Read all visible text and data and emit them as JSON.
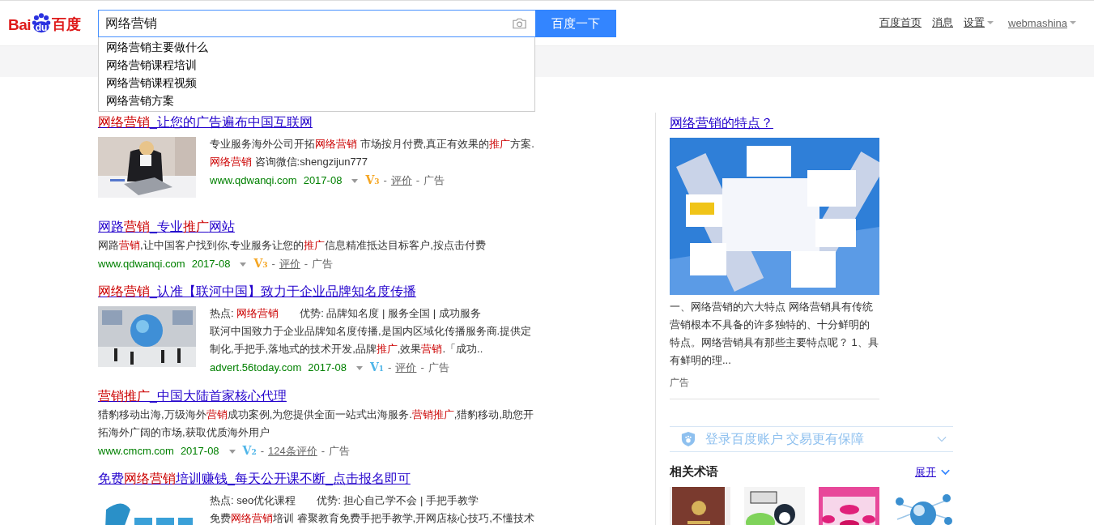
{
  "logo": {
    "left": "Bai",
    "badge": "du",
    "right": "百度"
  },
  "search": {
    "value": "网络营销",
    "button": "百度一下"
  },
  "suggestions": [
    "网络营销主要做什么",
    "网络营销课程培训",
    "网络营销课程视频",
    "网络营销方案"
  ],
  "nav": [
    {
      "label": "百度首页",
      "dropdown": false
    },
    {
      "label": "消息",
      "dropdown": false
    },
    {
      "label": "设置",
      "dropdown": true
    },
    {
      "label": "webmashina",
      "dropdown": true
    }
  ],
  "results": [
    {
      "title": "**网络营销**_让您的广告遍布中国互联网",
      "thumb": {
        "kind": "picture"
      },
      "lines": [
        "专业服务海外公司开拓**网络营销** 市场按月付费,真正有效果的**推广**方案.",
        "**网络营销** 咨询微信:shengzijun777"
      ],
      "meta": {
        "url": "www.qdwanqi.com",
        "date": "2017-08",
        "vip": "V3",
        "color": "#f5a623",
        "sep": "-",
        "review": "评价",
        "ad": "广告"
      }
    },
    {
      "title": "网路**营销**_专业**推广**网站",
      "lines": [
        "网路**营销**,让中国客户找到你,专业服务让您的**推广**信息精准抵达目标客户,按点击付费"
      ],
      "meta": {
        "url": "www.qdwanqi.com",
        "date": "2017-08",
        "vip": "V3",
        "color": "#f5a623",
        "sep": "-",
        "review": "评价",
        "ad": "广告"
      }
    },
    {
      "title": "**网络营销**_认准【联河中国】致力于企业品牌知名度传播",
      "thumb": {
        "kind": "picture"
      },
      "tags": [
        "热点: **网络营销**",
        "优势: 品牌知名度 | 服务全国 | 成功服务"
      ],
      "lines": [
        "联河中国致力于企业品牌知名度传播,是国内区域化传播服务商.提供定",
        "制化,手把手,落地式的技术开发,品牌**推广**,效果**营销**.「成功.."
      ],
      "meta": {
        "url": "advert.56today.com",
        "date": "2017-08",
        "vip": "V1",
        "color": "#4fb5e8",
        "sep": "-",
        "review": "评价",
        "ad": "广告"
      }
    },
    {
      "title": "**营销推广**_中国大陆首家核心代理",
      "lines": [
        "猎豹移动出海,万级海外**营销**成功案例,为您提供全面一站式出海服务.**营销推广**,猎豹移动,助您开",
        "拓海外广阔的市场,获取优质海外用户"
      ],
      "meta": {
        "url": "www.cmcm.com",
        "date": "2017-08",
        "vip": "V2",
        "color": "#4fb5e8",
        "sep": "-",
        "review": "124条评价",
        "ad": "广告"
      }
    },
    {
      "title": "免费**网络营销**培训赚钱_每天公开课不断_点击报名即可",
      "thumb": {
        "kind": "picture"
      },
      "tags": [
        "热点: seo优化课程",
        "优势: 担心自己学不会 | 手把手教学"
      ],
      "lines": [
        "免费**网络营销**培训 睿聚教育免费手把手教学,开网店核心技巧,不懂技术"
      ]
    }
  ],
  "sidebar": {
    "title": "网络营销的特点？",
    "text": "一、网络营销的六大特点 网络营销具有传统营销根本不具备的许多独特的、十分鲜明的特点。网络营销具有那些主要特点呢？ 1、具有鲜明的理...",
    "ad": "广告",
    "login": "登录百度账户 交易更有保障",
    "related": {
      "title": "相关术语",
      "expand": "展开",
      "thumbs": [
        {
          "kind": "picture"
        },
        {
          "kind": "picture"
        },
        {
          "kind": "picture"
        },
        {
          "kind": "picture"
        }
      ]
    }
  }
}
